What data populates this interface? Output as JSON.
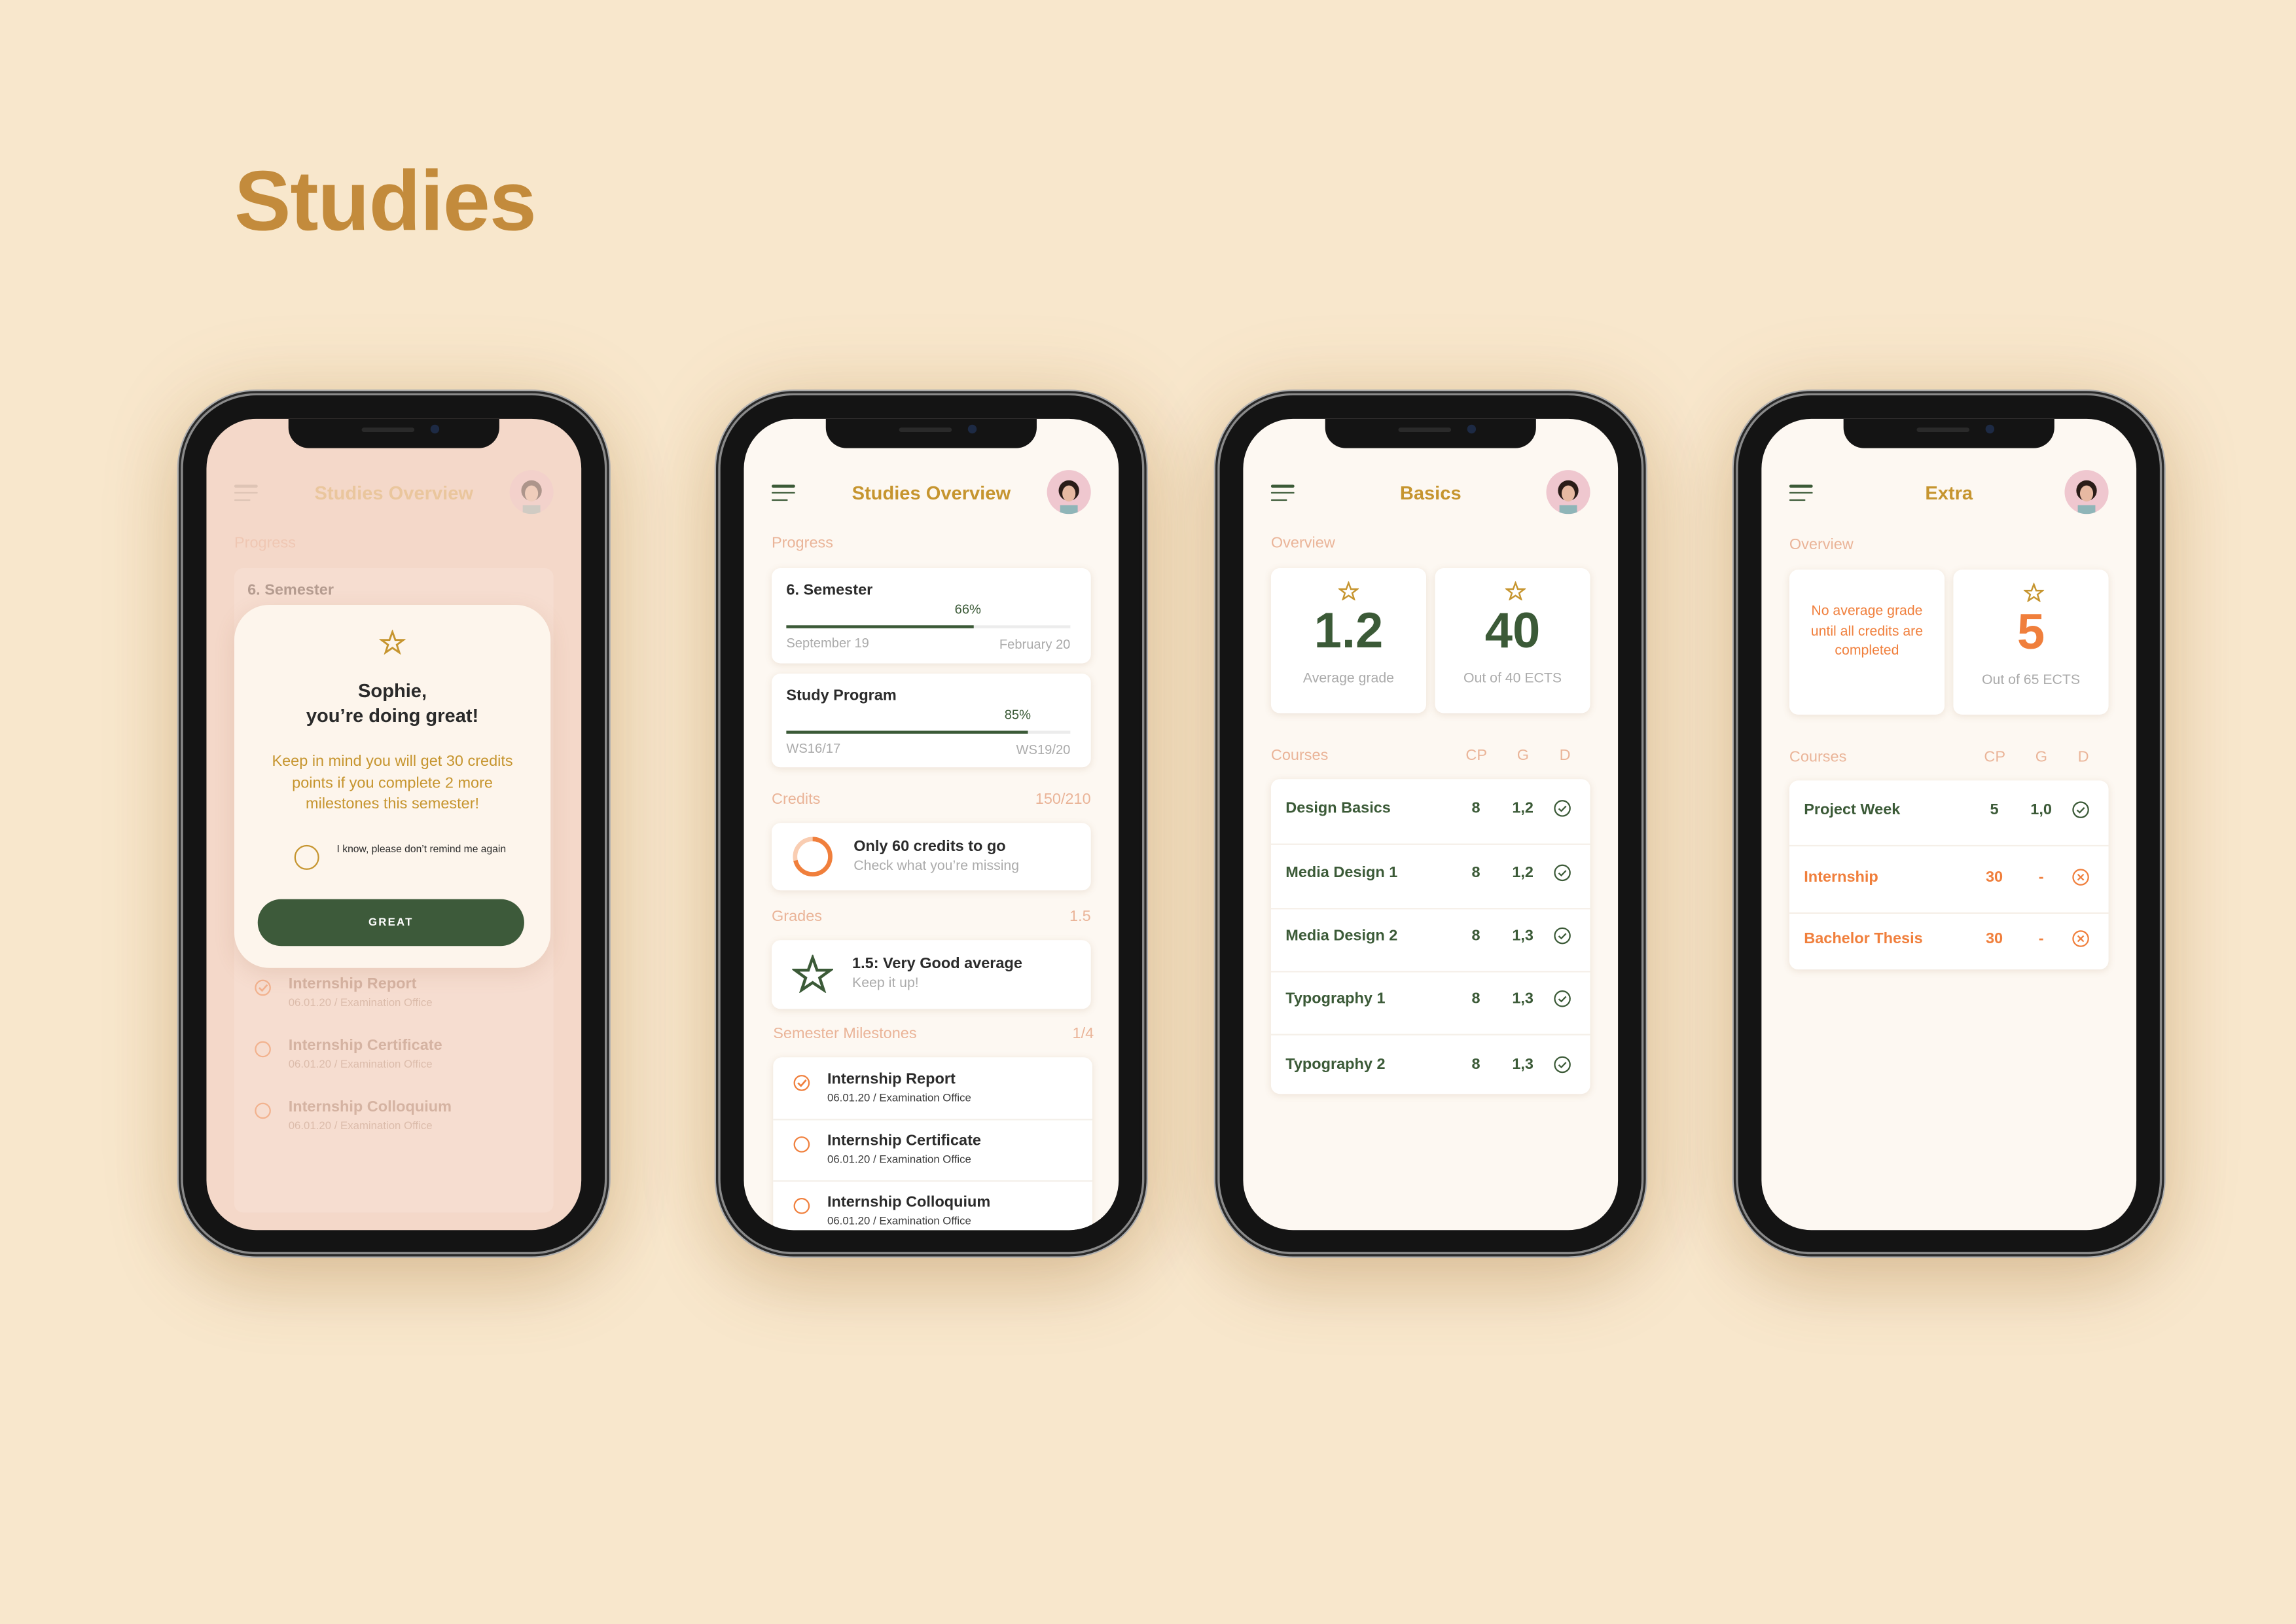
{
  "page_title": "Studies",
  "colors": {
    "background": "#f8e7cc",
    "gold": "#c6952f",
    "green": "#3b5a37",
    "orange": "#f07f3c",
    "peach": "#eab498"
  },
  "phone1": {
    "title": "Studies Overview",
    "progress_label": "Progress",
    "semester": "6. Semester",
    "modal": {
      "heading_line1": "Sophie,",
      "heading_line2": "you’re doing great!",
      "body": "Keep in mind you will get 30 credits points if you complete 2 more milestones this semester!",
      "checkbox_label": "I know, please don’t remind me again",
      "checkbox_checked": false,
      "button": "GREAT"
    },
    "milestones": [
      {
        "title": "Internship Report",
        "sub": "06.01.20 / Examination Office",
        "done": true
      },
      {
        "title": "Internship Certificate",
        "sub": "06.01.20 / Examination Office",
        "done": false
      },
      {
        "title": "Internship Colloquium",
        "sub": "06.01.20 / Examination Office",
        "done": false
      }
    ]
  },
  "phone2": {
    "title": "Studies Overview",
    "progress_label": "Progress",
    "semester": {
      "name": "6. Semester",
      "percent": "66%",
      "progress": 0.66,
      "start": "September 19",
      "end": "February 20"
    },
    "program": {
      "name": "Study Program",
      "percent": "85%",
      "progress": 0.85,
      "start": "WS16/17",
      "end": "WS19/20"
    },
    "credits": {
      "label": "Credits",
      "value": "150/210",
      "progress": 0.714,
      "title": "Only 60 credits to go",
      "sub": "Check what you’re missing"
    },
    "grades": {
      "label": "Grades",
      "value": "1.5",
      "title": "1.5: Very Good average",
      "sub": "Keep it up!"
    },
    "milestones": {
      "label": "Semester Milestones",
      "value": "1/4",
      "items": [
        {
          "title": "Internship Report",
          "sub": "06.01.20 / Examination Office",
          "done": true
        },
        {
          "title": "Internship Certificate",
          "sub": "06.01.20 / Examination Office",
          "done": false
        },
        {
          "title": "Internship Colloquium",
          "sub": "06.01.20 / Examination Office",
          "done": false
        }
      ]
    }
  },
  "phone3": {
    "title": "Basics",
    "overview_label": "Overview",
    "grade": {
      "value": "1.2",
      "label": "Average grade"
    },
    "ects": {
      "value": "40",
      "label": "Out of 40 ECTS"
    },
    "courses_label": "Courses",
    "col_cp": "CP",
    "col_g": "G",
    "col_d": "D",
    "courses": [
      {
        "name": "Design Basics",
        "cp": "8",
        "g": "1,2",
        "done": true
      },
      {
        "name": "Media Design 1",
        "cp": "8",
        "g": "1,2",
        "done": true
      },
      {
        "name": "Media Design 2",
        "cp": "8",
        "g": "1,3",
        "done": true
      },
      {
        "name": "Typography 1",
        "cp": "8",
        "g": "1,3",
        "done": true
      },
      {
        "name": "Typography 2",
        "cp": "8",
        "g": "1,3",
        "done": true
      }
    ]
  },
  "phone4": {
    "title": "Extra",
    "overview_label": "Overview",
    "no_grade": "No average grade until all credits are completed",
    "ects": {
      "value": "5",
      "label": "Out of 65 ECTS"
    },
    "courses_label": "Courses",
    "col_cp": "CP",
    "col_g": "G",
    "col_d": "D",
    "courses": [
      {
        "name": "Project Week",
        "cp": "5",
        "g": "1,0",
        "done": true
      },
      {
        "name": "Internship",
        "cp": "30",
        "g": "-",
        "done": false
      },
      {
        "name": "Bachelor Thesis",
        "cp": "30",
        "g": "-",
        "done": false
      }
    ]
  }
}
